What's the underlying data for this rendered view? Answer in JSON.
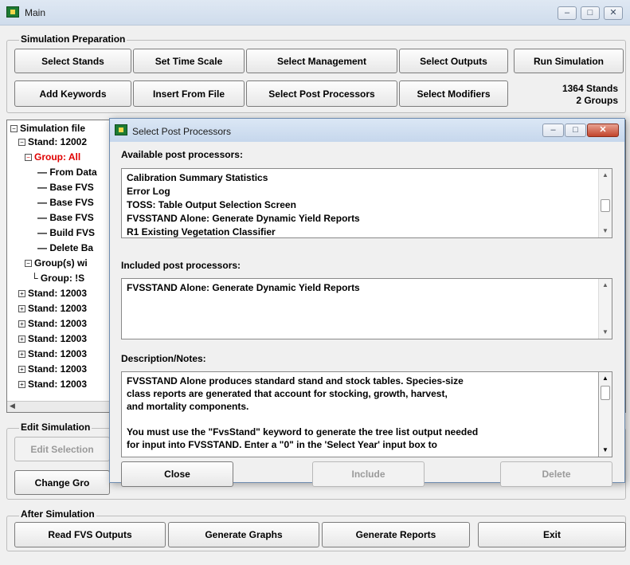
{
  "window": {
    "title": "Main",
    "controls": [
      "‒",
      "□",
      "✕"
    ]
  },
  "prep": {
    "label": "Simulation Preparation",
    "buttons": {
      "select_stands": "Select Stands",
      "set_time_scale": "Set Time Scale",
      "select_management": "Select Management",
      "select_outputs": "Select Outputs",
      "run_simulation": "Run Simulation",
      "add_keywords": "Add Keywords",
      "insert_from_file": "Insert From File",
      "select_post_processors": "Select Post Processors",
      "select_modifiers": "Select Modifiers"
    },
    "stands_count": "1364 Stands",
    "groups_count": "2 Groups"
  },
  "tree": {
    "rows": [
      "Simulation file",
      "Stand: 12002",
      "Group: All",
      "From Data",
      "Base FVS",
      "Base FVS",
      "Base FVS",
      "Build FVS",
      "Delete Ba",
      "Group(s) wi",
      "Group: !S",
      "Stand: 12003",
      "Stand: 12003",
      "Stand: 12003",
      "Stand: 12003",
      "Stand: 12003",
      "Stand: 12003",
      "Stand: 12003"
    ]
  },
  "edit": {
    "label": "Edit Simulation",
    "edit_selection": "Edit Selection",
    "change_group": "Change Gro"
  },
  "after": {
    "label": "After Simulation",
    "read_outputs": "Read FVS Outputs",
    "generate_graphs": "Generate Graphs",
    "generate_reports": "Generate Reports",
    "exit": "Exit"
  },
  "dialog": {
    "title": "Select Post Processors",
    "controls": [
      "‒",
      "□",
      "✕"
    ],
    "available_label": "Available post processors:",
    "available_items": [
      "Calibration Summary Statistics",
      "Error Log",
      "TOSS: Table Output Selection Screen",
      "FVSSTAND Alone: Generate Dynamic Yield Reports",
      "R1 Existing Vegetation Classifier"
    ],
    "included_label": "Included post processors:",
    "included_items": [
      "FVSSTAND Alone: Generate Dynamic Yield Reports"
    ],
    "description_label": "Description/Notes:",
    "description_lines": [
      "FVSSTAND Alone produces standard stand and stock tables.  Species-size",
      "class reports are generated that account for stocking, growth, harvest,",
      "and mortality components.",
      "",
      "You must use the \"FvsStand\" keyword to generate the tree list output needed",
      "for input into FVSSTAND.  Enter a \"0\" in the 'Select Year' input box to"
    ],
    "close": "Close",
    "include": "Include",
    "delete": "Delete"
  },
  "colors": {
    "group_all": "#e00000",
    "title_bar": "#cfdcec",
    "dialog_close": "#c2452c"
  }
}
